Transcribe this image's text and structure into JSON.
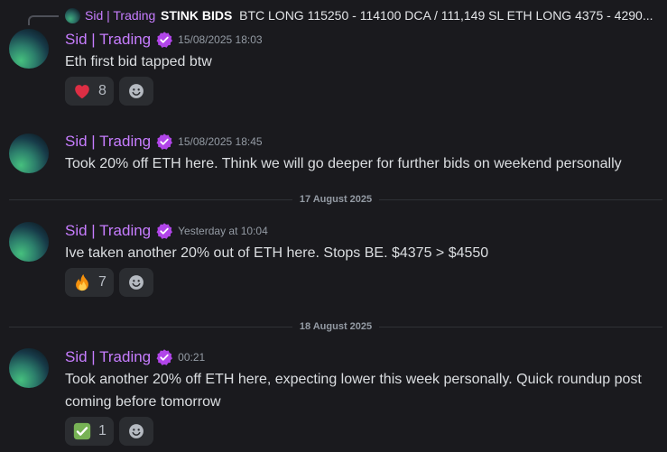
{
  "reply": {
    "author": "Sid | Trading",
    "bold_text": "STINK BIDS",
    "text": "BTC LONG 115250 - 114100 DCA / 111,149 SL  ETH LONG 4375 - 4290..."
  },
  "messages": [
    {
      "author": "Sid | Trading",
      "timestamp": "15/08/2025 18:03",
      "content": "Eth first bid tapped btw",
      "reaction": {
        "emoji": "heart",
        "count": "8"
      }
    },
    {
      "author": "Sid | Trading",
      "timestamp": "15/08/2025 18:45",
      "content": "Took 20% off ETH here. Think we will go deeper for further bids on weekend personally"
    },
    {
      "author": "Sid | Trading",
      "timestamp": "Yesterday at 10:04",
      "content": "Ive taken another 20% out of ETH here. Stops BE. $4375 > $4550",
      "reaction": {
        "emoji": "fire",
        "count": "7"
      }
    },
    {
      "author": "Sid | Trading",
      "timestamp": "00:21",
      "content": "Took another 20% off ETH here, expecting lower this week personally. Quick roundup post coming before tomorrow",
      "reaction": {
        "emoji": "check-mark",
        "count": "1"
      }
    }
  ],
  "dividers": [
    "17 August 2025",
    "18 August 2025"
  ],
  "colors": {
    "background": "#1a1a1e",
    "author": "#c77dff",
    "reaction_bg": "#2b2d31"
  }
}
